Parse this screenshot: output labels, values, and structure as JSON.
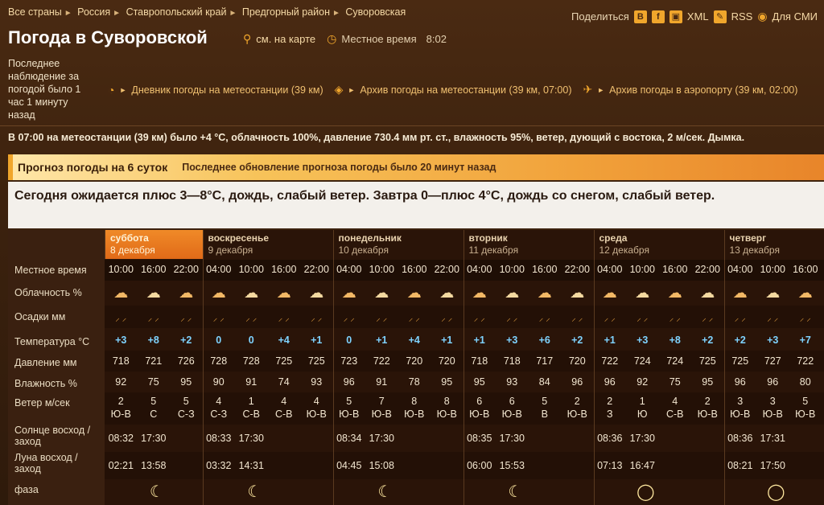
{
  "breadcrumbs": [
    "Все страны",
    "Россия",
    "Ставропольский край",
    "Предгорный район",
    "Суворовская"
  ],
  "share": {
    "label": "Поделиться",
    "xml": "XML",
    "rss": "RSS",
    "media": "Для СМИ",
    "b": "B",
    "f": "f"
  },
  "page_title": "Погода в Суворовской",
  "map_link": "см. на карте",
  "local_time_label": "Местное время",
  "local_time_value": "8:02",
  "last_observation": "Последнее наблюдение за погодой было 1 час 1 минуту назад",
  "links": {
    "diary": "Дневник погоды на метеостанции (39 км)",
    "archive": "Архив погоды на метеостанции (39 км, 07:00)",
    "airport": "Архив погоды в аэропорту (39 км, 02:00)"
  },
  "observation_line": "В 07:00 на метеостанции (39 км) было +4 °C, облачность 100%, давление 730.4 мм рт. ст., влажность 95%, ветер, дующий с востока, 2 м/сек. Дымка.",
  "forecast": {
    "title": "Прогноз погоды на 6 суток",
    "updated": "Последнее обновление прогноза погоды было 20 минут назад",
    "summary": "Сегодня ожидается плюс 3—8°C, дождь, слабый ветер. Завтра 0—плюс 4°C, дождь со снегом, слабый ветер."
  },
  "row_labels": {
    "time": "Местное время",
    "clouds": "Облачность %",
    "precip": "Осадки мм",
    "temp": "Температура °C",
    "pressure": "Давление мм",
    "humidity": "Влажность %",
    "wind": "Ветер м/сек",
    "sun": "Солнце восход / заход",
    "moon": "Луна восход / заход",
    "phase": "фаза"
  },
  "days": [
    {
      "name": "суббота",
      "date": "8 декабря",
      "times": [
        "10:00",
        "16:00",
        "22:00"
      ],
      "temps": [
        "+3",
        "+8",
        "+2"
      ],
      "pressure": [
        "718",
        "721",
        "726"
      ],
      "humidity": [
        "92",
        "75",
        "95"
      ],
      "wind_speed": [
        "2",
        "5",
        "5"
      ],
      "wind_dir": [
        "Ю-В",
        "С",
        "С-З"
      ],
      "sun": [
        "08:32",
        "17:30"
      ],
      "moon": [
        "02:21",
        "13:58"
      ]
    },
    {
      "name": "воскресенье",
      "date": "9 декабря",
      "times": [
        "04:00",
        "10:00",
        "16:00",
        "22:00"
      ],
      "temps": [
        "0",
        "0",
        "+4",
        "+1"
      ],
      "pressure": [
        "728",
        "728",
        "725",
        "725"
      ],
      "humidity": [
        "90",
        "91",
        "74",
        "93"
      ],
      "wind_speed": [
        "4",
        "1",
        "4",
        "4"
      ],
      "wind_dir": [
        "С-З",
        "С-В",
        "С-В",
        "Ю-В"
      ],
      "sun": [
        "08:33",
        "17:30"
      ],
      "moon": [
        "03:32",
        "14:31"
      ]
    },
    {
      "name": "понедельник",
      "date": "10 декабря",
      "times": [
        "04:00",
        "10:00",
        "16:00",
        "22:00"
      ],
      "temps": [
        "0",
        "+1",
        "+4",
        "+1"
      ],
      "pressure": [
        "723",
        "722",
        "720",
        "720"
      ],
      "humidity": [
        "96",
        "91",
        "78",
        "95"
      ],
      "wind_speed": [
        "5",
        "7",
        "8",
        "8"
      ],
      "wind_dir": [
        "Ю-В",
        "Ю-В",
        "Ю-В",
        "Ю-В"
      ],
      "sun": [
        "08:34",
        "17:30"
      ],
      "moon": [
        "04:45",
        "15:08"
      ]
    },
    {
      "name": "вторник",
      "date": "11 декабря",
      "times": [
        "04:00",
        "10:00",
        "16:00",
        "22:00"
      ],
      "temps": [
        "+1",
        "+3",
        "+6",
        "+2"
      ],
      "pressure": [
        "718",
        "718",
        "717",
        "720"
      ],
      "humidity": [
        "95",
        "93",
        "84",
        "96"
      ],
      "wind_speed": [
        "6",
        "6",
        "5",
        "2"
      ],
      "wind_dir": [
        "Ю-В",
        "Ю-В",
        "В",
        "Ю-В"
      ],
      "sun": [
        "08:35",
        "17:30"
      ],
      "moon": [
        "06:00",
        "15:53"
      ]
    },
    {
      "name": "среда",
      "date": "12 декабря",
      "times": [
        "04:00",
        "10:00",
        "16:00",
        "22:00"
      ],
      "temps": [
        "+1",
        "+3",
        "+8",
        "+2"
      ],
      "pressure": [
        "722",
        "724",
        "724",
        "725"
      ],
      "humidity": [
        "96",
        "92",
        "75",
        "95"
      ],
      "wind_speed": [
        "2",
        "1",
        "4",
        "2"
      ],
      "wind_dir": [
        "З",
        "Ю",
        "С-В",
        "Ю-В"
      ],
      "sun": [
        "08:36",
        "17:30"
      ],
      "moon": [
        "07:13",
        "16:47"
      ]
    },
    {
      "name": "четверг",
      "date": "13 декабря",
      "times": [
        "04:00",
        "10:00",
        "16:00"
      ],
      "temps": [
        "+2",
        "+3",
        "+7"
      ],
      "pressure": [
        "725",
        "727",
        "722"
      ],
      "humidity": [
        "96",
        "96",
        "80"
      ],
      "wind_speed": [
        "3",
        "3",
        "5"
      ],
      "wind_dir": [
        "Ю-В",
        "Ю-В",
        "Ю-В"
      ],
      "sun": [
        "08:36",
        "17:31"
      ],
      "moon": [
        "08:21",
        "17:50"
      ]
    }
  ],
  "colors": {
    "accent": "#f0a62c",
    "today": "#e87a20",
    "temp": "#7fd3ff",
    "bg": "#3c220e"
  }
}
